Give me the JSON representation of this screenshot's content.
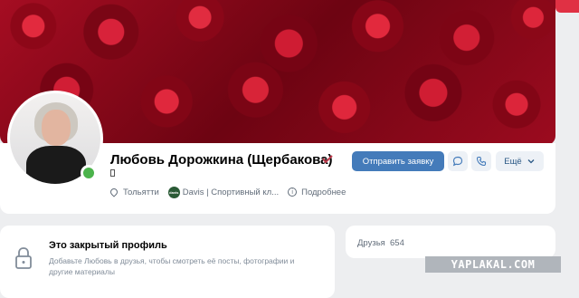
{
  "profile": {
    "name": "Любовь Дорожкина (Щербакова)",
    "verified_icon": "checkmark-badge-icon",
    "status_icon": "doc-icon",
    "location": "Тольятти",
    "work_logo_text": "davis",
    "work": "Davis | Спортивный кл...",
    "more_info": "Подробнее",
    "online": true
  },
  "actions": {
    "send_request": "Отправить заявку",
    "message_icon": "message-icon",
    "call_icon": "phone-icon",
    "more": "Ещё"
  },
  "private_profile": {
    "title": "Это закрытый профиль",
    "description": "Добавьте Любовь в друзья, чтобы смотреть её посты, фотографии и другие материалы"
  },
  "friends": {
    "label": "Друзья",
    "count": "654"
  },
  "watermark": "YAPLAKAL.COM",
  "colors": {
    "primary_button": "#447bba",
    "online": "#4bb34b",
    "background": "#edeef0"
  }
}
